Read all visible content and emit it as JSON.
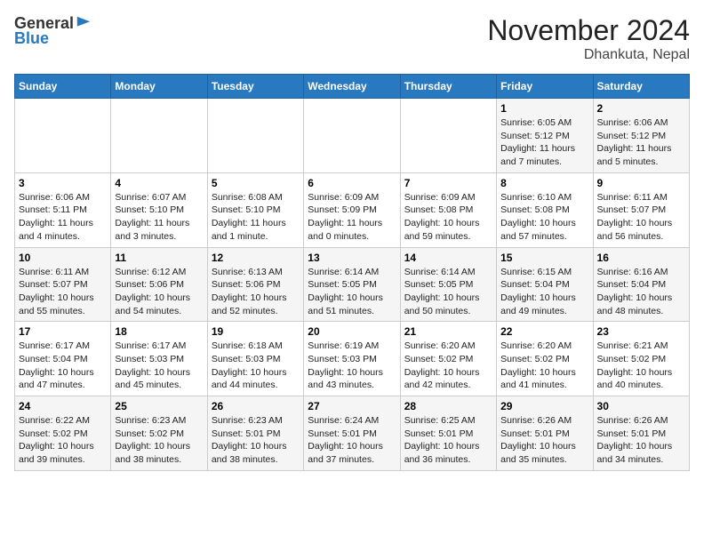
{
  "header": {
    "logo_line1": "General",
    "logo_line2": "Blue",
    "title": "November 2024",
    "subtitle": "Dhankuta, Nepal"
  },
  "calendar": {
    "days_of_week": [
      "Sunday",
      "Monday",
      "Tuesday",
      "Wednesday",
      "Thursday",
      "Friday",
      "Saturday"
    ],
    "weeks": [
      [
        {
          "day": "",
          "info": ""
        },
        {
          "day": "",
          "info": ""
        },
        {
          "day": "",
          "info": ""
        },
        {
          "day": "",
          "info": ""
        },
        {
          "day": "",
          "info": ""
        },
        {
          "day": "1",
          "info": "Sunrise: 6:05 AM\nSunset: 5:12 PM\nDaylight: 11 hours and 7 minutes."
        },
        {
          "day": "2",
          "info": "Sunrise: 6:06 AM\nSunset: 5:12 PM\nDaylight: 11 hours and 5 minutes."
        }
      ],
      [
        {
          "day": "3",
          "info": "Sunrise: 6:06 AM\nSunset: 5:11 PM\nDaylight: 11 hours and 4 minutes."
        },
        {
          "day": "4",
          "info": "Sunrise: 6:07 AM\nSunset: 5:10 PM\nDaylight: 11 hours and 3 minutes."
        },
        {
          "day": "5",
          "info": "Sunrise: 6:08 AM\nSunset: 5:10 PM\nDaylight: 11 hours and 1 minute."
        },
        {
          "day": "6",
          "info": "Sunrise: 6:09 AM\nSunset: 5:09 PM\nDaylight: 11 hours and 0 minutes."
        },
        {
          "day": "7",
          "info": "Sunrise: 6:09 AM\nSunset: 5:08 PM\nDaylight: 10 hours and 59 minutes."
        },
        {
          "day": "8",
          "info": "Sunrise: 6:10 AM\nSunset: 5:08 PM\nDaylight: 10 hours and 57 minutes."
        },
        {
          "day": "9",
          "info": "Sunrise: 6:11 AM\nSunset: 5:07 PM\nDaylight: 10 hours and 56 minutes."
        }
      ],
      [
        {
          "day": "10",
          "info": "Sunrise: 6:11 AM\nSunset: 5:07 PM\nDaylight: 10 hours and 55 minutes."
        },
        {
          "day": "11",
          "info": "Sunrise: 6:12 AM\nSunset: 5:06 PM\nDaylight: 10 hours and 54 minutes."
        },
        {
          "day": "12",
          "info": "Sunrise: 6:13 AM\nSunset: 5:06 PM\nDaylight: 10 hours and 52 minutes."
        },
        {
          "day": "13",
          "info": "Sunrise: 6:14 AM\nSunset: 5:05 PM\nDaylight: 10 hours and 51 minutes."
        },
        {
          "day": "14",
          "info": "Sunrise: 6:14 AM\nSunset: 5:05 PM\nDaylight: 10 hours and 50 minutes."
        },
        {
          "day": "15",
          "info": "Sunrise: 6:15 AM\nSunset: 5:04 PM\nDaylight: 10 hours and 49 minutes."
        },
        {
          "day": "16",
          "info": "Sunrise: 6:16 AM\nSunset: 5:04 PM\nDaylight: 10 hours and 48 minutes."
        }
      ],
      [
        {
          "day": "17",
          "info": "Sunrise: 6:17 AM\nSunset: 5:04 PM\nDaylight: 10 hours and 47 minutes."
        },
        {
          "day": "18",
          "info": "Sunrise: 6:17 AM\nSunset: 5:03 PM\nDaylight: 10 hours and 45 minutes."
        },
        {
          "day": "19",
          "info": "Sunrise: 6:18 AM\nSunset: 5:03 PM\nDaylight: 10 hours and 44 minutes."
        },
        {
          "day": "20",
          "info": "Sunrise: 6:19 AM\nSunset: 5:03 PM\nDaylight: 10 hours and 43 minutes."
        },
        {
          "day": "21",
          "info": "Sunrise: 6:20 AM\nSunset: 5:02 PM\nDaylight: 10 hours and 42 minutes."
        },
        {
          "day": "22",
          "info": "Sunrise: 6:20 AM\nSunset: 5:02 PM\nDaylight: 10 hours and 41 minutes."
        },
        {
          "day": "23",
          "info": "Sunrise: 6:21 AM\nSunset: 5:02 PM\nDaylight: 10 hours and 40 minutes."
        }
      ],
      [
        {
          "day": "24",
          "info": "Sunrise: 6:22 AM\nSunset: 5:02 PM\nDaylight: 10 hours and 39 minutes."
        },
        {
          "day": "25",
          "info": "Sunrise: 6:23 AM\nSunset: 5:02 PM\nDaylight: 10 hours and 38 minutes."
        },
        {
          "day": "26",
          "info": "Sunrise: 6:23 AM\nSunset: 5:01 PM\nDaylight: 10 hours and 38 minutes."
        },
        {
          "day": "27",
          "info": "Sunrise: 6:24 AM\nSunset: 5:01 PM\nDaylight: 10 hours and 37 minutes."
        },
        {
          "day": "28",
          "info": "Sunrise: 6:25 AM\nSunset: 5:01 PM\nDaylight: 10 hours and 36 minutes."
        },
        {
          "day": "29",
          "info": "Sunrise: 6:26 AM\nSunset: 5:01 PM\nDaylight: 10 hours and 35 minutes."
        },
        {
          "day": "30",
          "info": "Sunrise: 6:26 AM\nSunset: 5:01 PM\nDaylight: 10 hours and 34 minutes."
        }
      ]
    ]
  }
}
